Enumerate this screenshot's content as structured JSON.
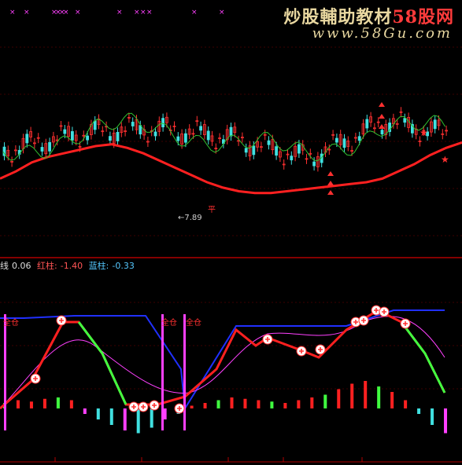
{
  "watermark": {
    "line1_prefix": "炒股輔助教材",
    "line1_brand": "58股网",
    "line2": "www.58Gu.com"
  },
  "top_panel": {
    "low_marker": "←7.89",
    "top_markers": "×",
    "cross_marker": "平"
  },
  "indicator_panel": {
    "legend_a_label": "线",
    "legend_a_value": "0.06",
    "legend_red_label": "红柱:",
    "legend_red_value": "-1.40",
    "legend_blue_label": "蓝柱:",
    "legend_blue_value": "-0.33",
    "tag_text": "全仓"
  },
  "colors": {
    "background": "#000000",
    "red": "#ff2020",
    "green_ma": "#30c030",
    "pink_line": "#ff40ff",
    "blue_line": "#2030ff",
    "bright_green": "#40ff40",
    "cyan_bar": "#40e0e0",
    "magenta_bar": "#ff40ff",
    "grid": "#7a0000"
  },
  "chart_data": [
    {
      "type": "line",
      "series": [
        {
          "values": [
            0.62,
            0.66,
            0.71,
            0.74,
            0.76,
            0.78,
            0.8,
            0.81,
            0.79,
            0.76,
            0.72,
            0.68,
            0.64,
            0.6,
            0.57,
            0.55,
            0.54,
            0.54,
            0.55,
            0.56,
            0.57,
            0.58,
            0.59,
            0.6,
            0.62,
            0.66,
            0.7,
            0.75,
            0.79,
            0.82
          ]
        }
      ]
    },
    {
      "type": "bar",
      "values": [
        0.2,
        0.3,
        0.25,
        0.35,
        0.4,
        0.3,
        -0.2,
        -0.4,
        -0.6,
        -0.8,
        -0.9,
        -0.7,
        -0.4,
        -0.2,
        0.1,
        0.2,
        0.3,
        0.4,
        0.35,
        0.3,
        0.25,
        0.2,
        0.3,
        0.4,
        0.5,
        0.7,
        0.9,
        1.0,
        0.8,
        0.6,
        0.3,
        -0.2,
        -0.6,
        -0.9
      ]
    }
  ]
}
